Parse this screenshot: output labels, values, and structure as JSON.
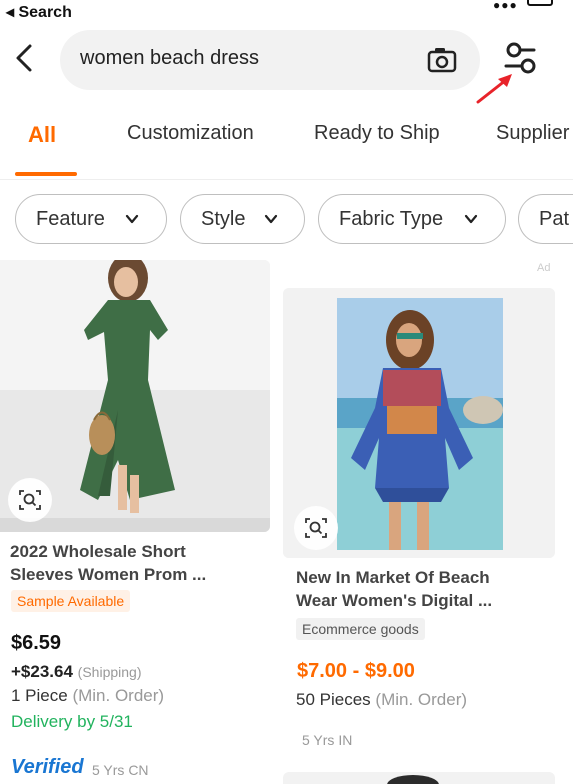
{
  "status_bar": {
    "back_label": "◂ Search"
  },
  "search": {
    "query": "women beach dress"
  },
  "tabs": [
    {
      "label": "All"
    },
    {
      "label": "Customization"
    },
    {
      "label": "Ready to Ship"
    },
    {
      "label": "Supplier"
    }
  ],
  "filters": [
    {
      "label": "Feature"
    },
    {
      "label": "Style"
    },
    {
      "label": "Fabric Type"
    },
    {
      "label": "Pat"
    }
  ],
  "products": [
    {
      "title_line1": "2022 Wholesale Short",
      "title_line2": "Sleeves Women Prom ...",
      "badge": "Sample Available",
      "price": "$6.59",
      "shipping_price": "+$23.64",
      "shipping_label": "(Shipping)",
      "moq_value": "1 Piece",
      "moq_label": "(Min. Order)",
      "delivery": "Delivery by 5/31",
      "verified": "Verified",
      "supplier_meta": "5 Yrs  CN"
    },
    {
      "ad_label": "Ad",
      "title_line1": "New In Market Of Beach",
      "title_line2": "Wear Women's Digital ...",
      "badge": "Ecommerce goods",
      "price": "$7.00 - $9.00",
      "moq_value": "50 Pieces",
      "moq_label": "(Min. Order)",
      "supplier_meta": "5 Yrs  IN"
    }
  ],
  "colors": {
    "accent": "#ff6a00",
    "delivery_green": "#22b35e",
    "verified_blue": "#1976d2",
    "annotation_red": "#e8232a"
  }
}
